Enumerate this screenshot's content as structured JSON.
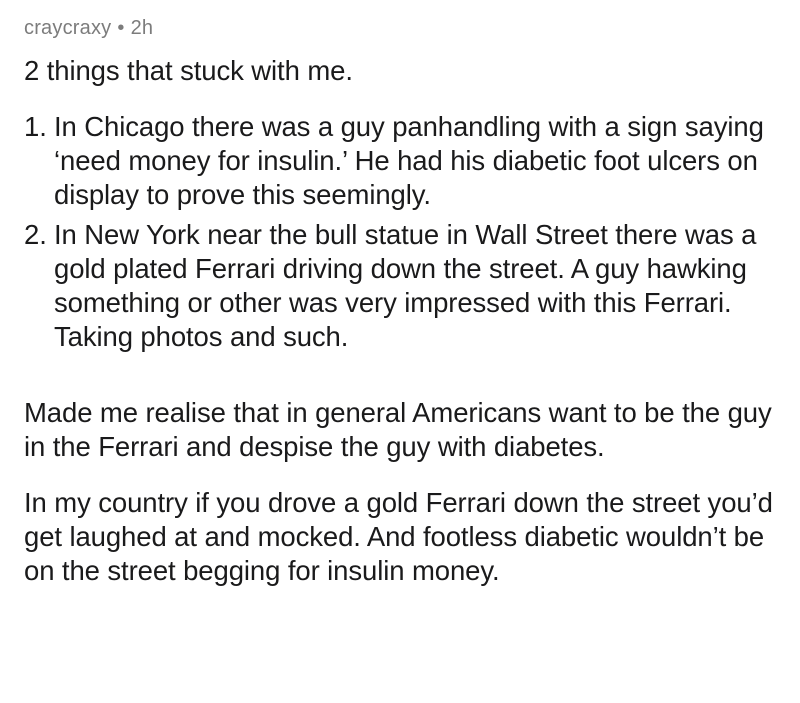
{
  "comment": {
    "author": "craycraxy",
    "separator": "•",
    "age": "2h",
    "intro": "2 things that stuck with me.",
    "items": [
      {
        "number": "1.",
        "text": "In Chicago there was a guy panhandling with a sign saying ‘need money for insulin.’ He had his diabetic foot ulcers on display to prove this seemingly."
      },
      {
        "number": "2.",
        "text": "In New York near the bull statue in Wall Street there was a gold plated Ferrari driving down the street. A guy hawking something or other was very impressed with this Ferrari. Taking photos and such."
      }
    ],
    "paragraph_1": "Made me realise that in general Americans want to be the guy in the Ferrari and despise the guy with diabetes.",
    "paragraph_2": "In my country if you drove a gold Ferrari down the street you’d get laughed at and mocked. And footless diabetic wouldn’t be on the street begging for insulin money."
  }
}
